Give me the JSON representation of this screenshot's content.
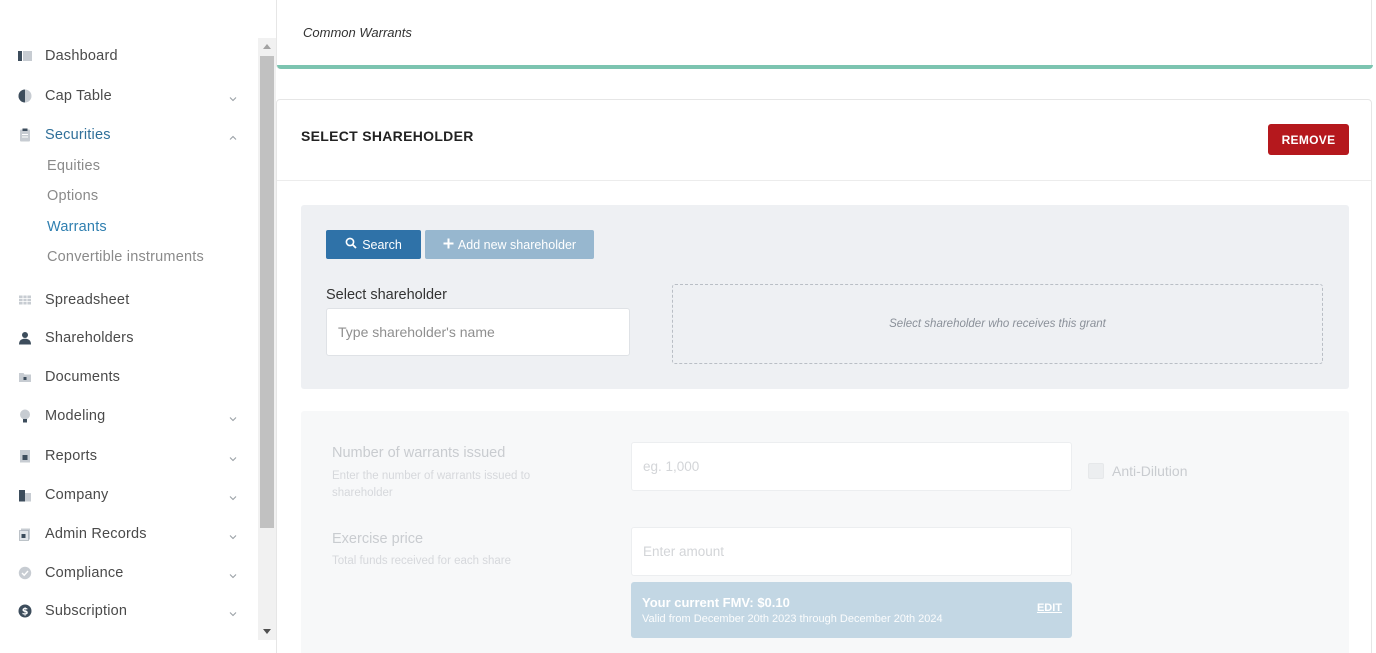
{
  "sidebar": {
    "items": [
      {
        "label": "Dashboard",
        "icon": "dashboard-icon"
      },
      {
        "label": "Cap Table",
        "icon": "pie-chart-icon"
      },
      {
        "label": "Securities",
        "icon": "clipboard-icon"
      },
      {
        "label": "Spreadsheet",
        "icon": "spreadsheet-icon"
      },
      {
        "label": "Shareholders",
        "icon": "person-icon"
      },
      {
        "label": "Documents",
        "icon": "folder-lock-icon"
      },
      {
        "label": "Modeling",
        "icon": "lightbulb-icon"
      },
      {
        "label": "Reports",
        "icon": "report-icon"
      },
      {
        "label": "Company",
        "icon": "building-icon"
      },
      {
        "label": "Admin Records",
        "icon": "admin-records-icon"
      },
      {
        "label": "Compliance",
        "icon": "shield-check-icon"
      },
      {
        "label": "Subscription",
        "icon": "dollar-circle-icon"
      }
    ],
    "securities_sub": [
      "Equities",
      "Options",
      "Warrants",
      "Convertible instruments"
    ],
    "active_item": "Securities",
    "active_sub": "Warrants"
  },
  "top_card": {
    "title": "Common Warrants"
  },
  "section": {
    "heading": "SELECT SHAREHOLDER",
    "remove_label": "REMOVE",
    "search_label": "Search",
    "add_label": "Add new shareholder",
    "select_label": "Select shareholder",
    "select_placeholder": "Type shareholder's name",
    "drop_hint": "Select shareholder who receives this grant"
  },
  "form": {
    "warrants_label": "Number of warrants issued",
    "warrants_help": "Enter the number of warrants issued to shareholder",
    "warrants_placeholder": "eg. 1,000",
    "anti_dilution_label": "Anti-Dilution",
    "exercise_label": "Exercise price",
    "exercise_help": "Total funds received for each share",
    "exercise_placeholder": "Enter amount",
    "fmv_title": "Your current FMV: $0.10",
    "fmv_valid": "Valid from December 20th 2023 through December 20th 2024",
    "fmv_edit": "EDIT"
  },
  "colors": {
    "accent_teal": "#7cc4b0",
    "primary_blue": "#2f72a8",
    "remove_red": "#b5181d",
    "active_link": "#2f7fb0"
  }
}
